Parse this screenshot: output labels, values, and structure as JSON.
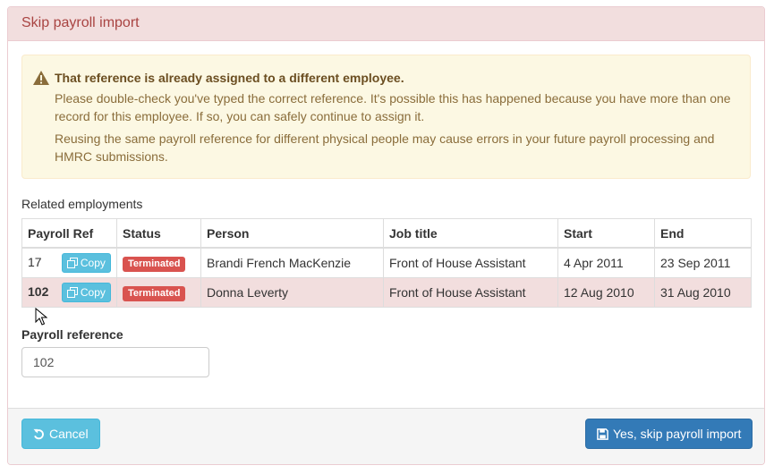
{
  "panel": {
    "title": "Skip payroll import"
  },
  "alert": {
    "title": "That reference is already assigned to a different employee.",
    "paragraph1": "Please double-check you've typed the correct reference. It's possible this has happened because you have more than one record for this employee. If so, you can safely continue to assign it.",
    "paragraph2": "Reusing the same payroll reference for different physical people may cause errors in your future payroll processing and HMRC submissions.",
    "icon": "warning-icon"
  },
  "related": {
    "label": "Related employments",
    "headers": [
      "Payroll Ref",
      "Status",
      "Person",
      "Job title",
      "Start",
      "End"
    ],
    "copy_label": "Copy",
    "rows": [
      {
        "ref": "17",
        "status": "Terminated",
        "person": "Brandi French MacKenzie",
        "job": "Front of House Assistant",
        "start": "4 Apr 2011",
        "end": "23 Sep 2011"
      },
      {
        "ref": "102",
        "status": "Terminated",
        "person": "Donna Leverty",
        "job": "Front of House Assistant",
        "start": "12 Aug 2010",
        "end": "31 Aug 2010"
      }
    ]
  },
  "form": {
    "label": "Payroll reference",
    "value": "102"
  },
  "footer": {
    "cancel_label": "Cancel",
    "skip_label": "Yes, skip payroll import"
  },
  "colors": {
    "danger": "#d9534f",
    "info": "#5bc0de",
    "primary": "#337ab7",
    "warning_bg": "#fcf8e3",
    "heading_bg": "#f2dede"
  }
}
